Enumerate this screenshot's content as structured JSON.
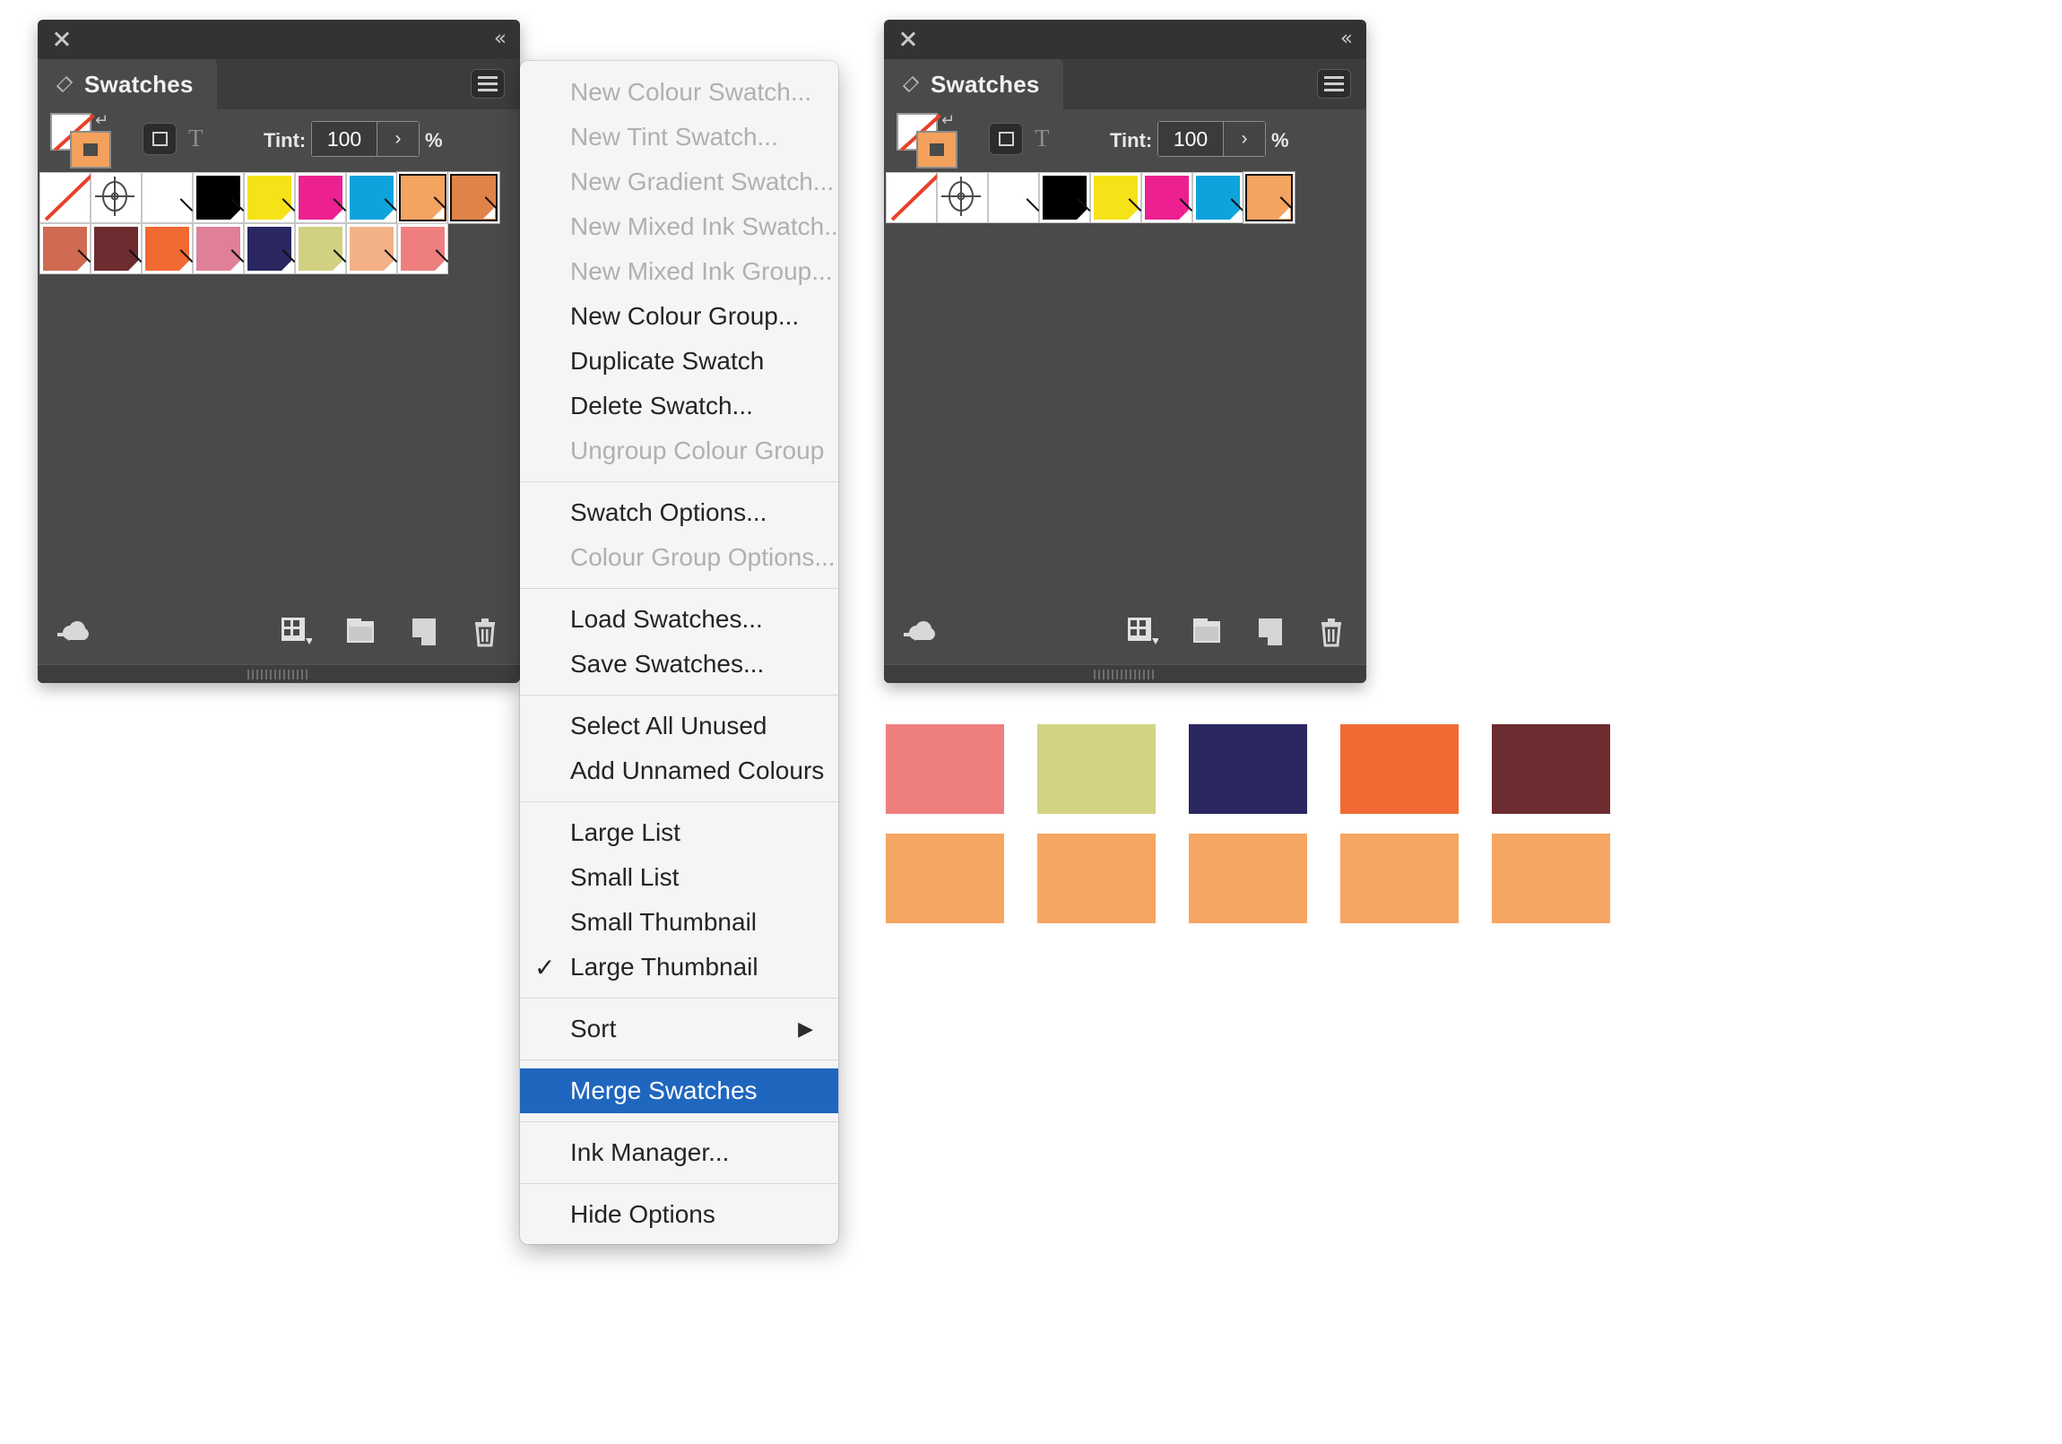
{
  "left_panel": {
    "name": "swatches-panel-expanded",
    "close_icon": "close-icon",
    "collapse_icon": "collapse-chevrons-icon",
    "tab_label": "Swatches",
    "menu_icon": "hamburger-menu-icon",
    "options": {
      "fill_stroke_icon": "fill-stroke-proxy",
      "swap_icon": "swap-fill-stroke-icon",
      "format_container_icon": "format-affects-container",
      "format_text_icon": "format-affects-text",
      "tint_label": "Tint:",
      "tint_value": "100",
      "tint_arrow": "›",
      "tint_unit": "%"
    },
    "swatch_rows": [
      [
        {
          "name": "none",
          "type": "none"
        },
        {
          "name": "registration",
          "type": "registration"
        },
        {
          "name": "paper",
          "type": "color",
          "color": "#ffffff"
        },
        {
          "name": "black",
          "type": "color",
          "color": "#000000"
        },
        {
          "name": "yellow",
          "type": "color",
          "color": "#f5e318"
        },
        {
          "name": "magenta",
          "type": "color",
          "color": "#ec2091"
        },
        {
          "name": "cyan",
          "type": "color",
          "color": "#0fa3dd"
        },
        {
          "name": "orange-light",
          "type": "color",
          "color": "#f4a461",
          "selected": true
        },
        {
          "name": "orange-dark",
          "type": "color",
          "color": "#e08349",
          "selected": true
        }
      ],
      [
        {
          "name": "terracotta",
          "type": "color",
          "color": "#d06a52"
        },
        {
          "name": "maroon",
          "type": "color",
          "color": "#6d2c2f"
        },
        {
          "name": "orange",
          "type": "color",
          "color": "#f26a33"
        },
        {
          "name": "pink",
          "type": "color",
          "color": "#e08098"
        },
        {
          "name": "navy",
          "type": "color",
          "color": "#2a2761"
        },
        {
          "name": "khaki",
          "type": "color",
          "color": "#d1d181"
        },
        {
          "name": "peach",
          "type": "color",
          "color": "#f4b188"
        },
        {
          "name": "salmon",
          "type": "color",
          "color": "#ef7f7f"
        }
      ]
    ],
    "bottom_icons": [
      {
        "name": "cc-libraries-icon"
      },
      {
        "name": "show-swatch-kinds-icon"
      },
      {
        "name": "new-colour-group-icon"
      },
      {
        "name": "new-swatch-icon"
      },
      {
        "name": "delete-swatch-icon"
      }
    ]
  },
  "right_panel": {
    "name": "swatches-panel-after-merge",
    "close_icon": "close-icon",
    "collapse_icon": "collapse-chevrons-icon",
    "tab_label": "Swatches",
    "menu_icon": "hamburger-menu-icon",
    "options": {
      "tint_label": "Tint:",
      "tint_value": "100",
      "tint_arrow": "›",
      "tint_unit": "%"
    },
    "swatch_rows": [
      [
        {
          "name": "none",
          "type": "none"
        },
        {
          "name": "registration",
          "type": "registration"
        },
        {
          "name": "paper",
          "type": "color",
          "color": "#ffffff"
        },
        {
          "name": "black",
          "type": "color",
          "color": "#000000"
        },
        {
          "name": "yellow",
          "type": "color",
          "color": "#f5e318"
        },
        {
          "name": "magenta",
          "type": "color",
          "color": "#ec2091"
        },
        {
          "name": "cyan",
          "type": "color",
          "color": "#0fa3dd"
        },
        {
          "name": "orange-merged",
          "type": "color",
          "color": "#f4a461",
          "selected": true
        }
      ]
    ]
  },
  "context_menu": {
    "name": "swatches-panel-menu",
    "groups": [
      {
        "items": [
          {
            "label": "New Colour Swatch...",
            "disabled": true
          },
          {
            "label": "New Tint Swatch...",
            "disabled": true
          },
          {
            "label": "New Gradient Swatch...",
            "disabled": true
          },
          {
            "label": "New Mixed Ink Swatch...",
            "disabled": true
          },
          {
            "label": "New Mixed Ink Group...",
            "disabled": true
          },
          {
            "label": "New Colour Group...",
            "disabled": false
          },
          {
            "label": "Duplicate Swatch",
            "disabled": false
          },
          {
            "label": "Delete Swatch...",
            "disabled": false
          },
          {
            "label": "Ungroup Colour Group",
            "disabled": true
          }
        ]
      },
      {
        "items": [
          {
            "label": "Swatch Options...",
            "disabled": false
          },
          {
            "label": "Colour Group Options...",
            "disabled": true
          }
        ]
      },
      {
        "items": [
          {
            "label": "Load Swatches...",
            "disabled": false
          },
          {
            "label": "Save Swatches...",
            "disabled": false
          }
        ]
      },
      {
        "items": [
          {
            "label": "Select All Unused",
            "disabled": false
          },
          {
            "label": "Add Unnamed Colours",
            "disabled": false
          }
        ]
      },
      {
        "items": [
          {
            "label": "Large List",
            "disabled": false
          },
          {
            "label": "Small List",
            "disabled": false
          },
          {
            "label": "Small Thumbnail",
            "disabled": false
          },
          {
            "label": "Large Thumbnail",
            "disabled": false,
            "checked": true,
            "check_glyph": "✓"
          }
        ]
      },
      {
        "items": [
          {
            "label": "Sort",
            "disabled": false,
            "submenu": true,
            "arrow_glyph": "▶"
          }
        ]
      },
      {
        "items": [
          {
            "label": "Merge Swatches",
            "disabled": false,
            "highlighted": true
          }
        ]
      },
      {
        "items": [
          {
            "label": "Ink Manager...",
            "disabled": false
          }
        ]
      },
      {
        "items": [
          {
            "label": "Hide Options",
            "disabled": false
          }
        ]
      }
    ],
    "highlight_color": "#1f66bf"
  },
  "colour_grid": {
    "name": "merged-colour-result-grid",
    "rows": [
      [
        "#ef7f7f",
        "#d3d384",
        "#2a2761",
        "#f26a33",
        "#6d2c2f"
      ],
      [
        "#f5a662",
        "#f5a662",
        "#f5a662",
        "#f5a662",
        "#f5a662"
      ]
    ]
  }
}
